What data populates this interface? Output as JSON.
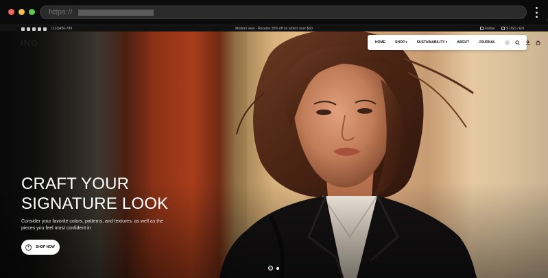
{
  "browser": {
    "url_text": "https://"
  },
  "announcement": {
    "phone": "(123)456-789",
    "promo": "Modern view - Receive 20% off on orders over $60",
    "utils": [
      "Follow",
      "$ USD / EN"
    ]
  },
  "site": {
    "logo": "ING"
  },
  "nav": {
    "items": [
      {
        "label": "HOME",
        "caret": false
      },
      {
        "label": "SHOP",
        "caret": true
      },
      {
        "label": "SUSTAINABILITY",
        "caret": true
      },
      {
        "label": "ABOUT",
        "caret": false
      },
      {
        "label": "JOURNAL",
        "caret": false
      }
    ],
    "icons": [
      "language-flag-icon",
      "search-icon",
      "account-icon",
      "bag-icon"
    ]
  },
  "hero": {
    "headline_line1": "CRAFT YOUR",
    "headline_line2": "SIGNATURE LOOK",
    "subtext": "Consider your favorite colors, patterns, and textures, as well as the pieces you feel most confident in",
    "cta_label": "SHOP NOW",
    "slides_total": 2,
    "slide_active": 1
  },
  "colors": {
    "accent_orange": "#c9491f",
    "nav_bg": "#ffffff",
    "headline": "#ffffff"
  }
}
